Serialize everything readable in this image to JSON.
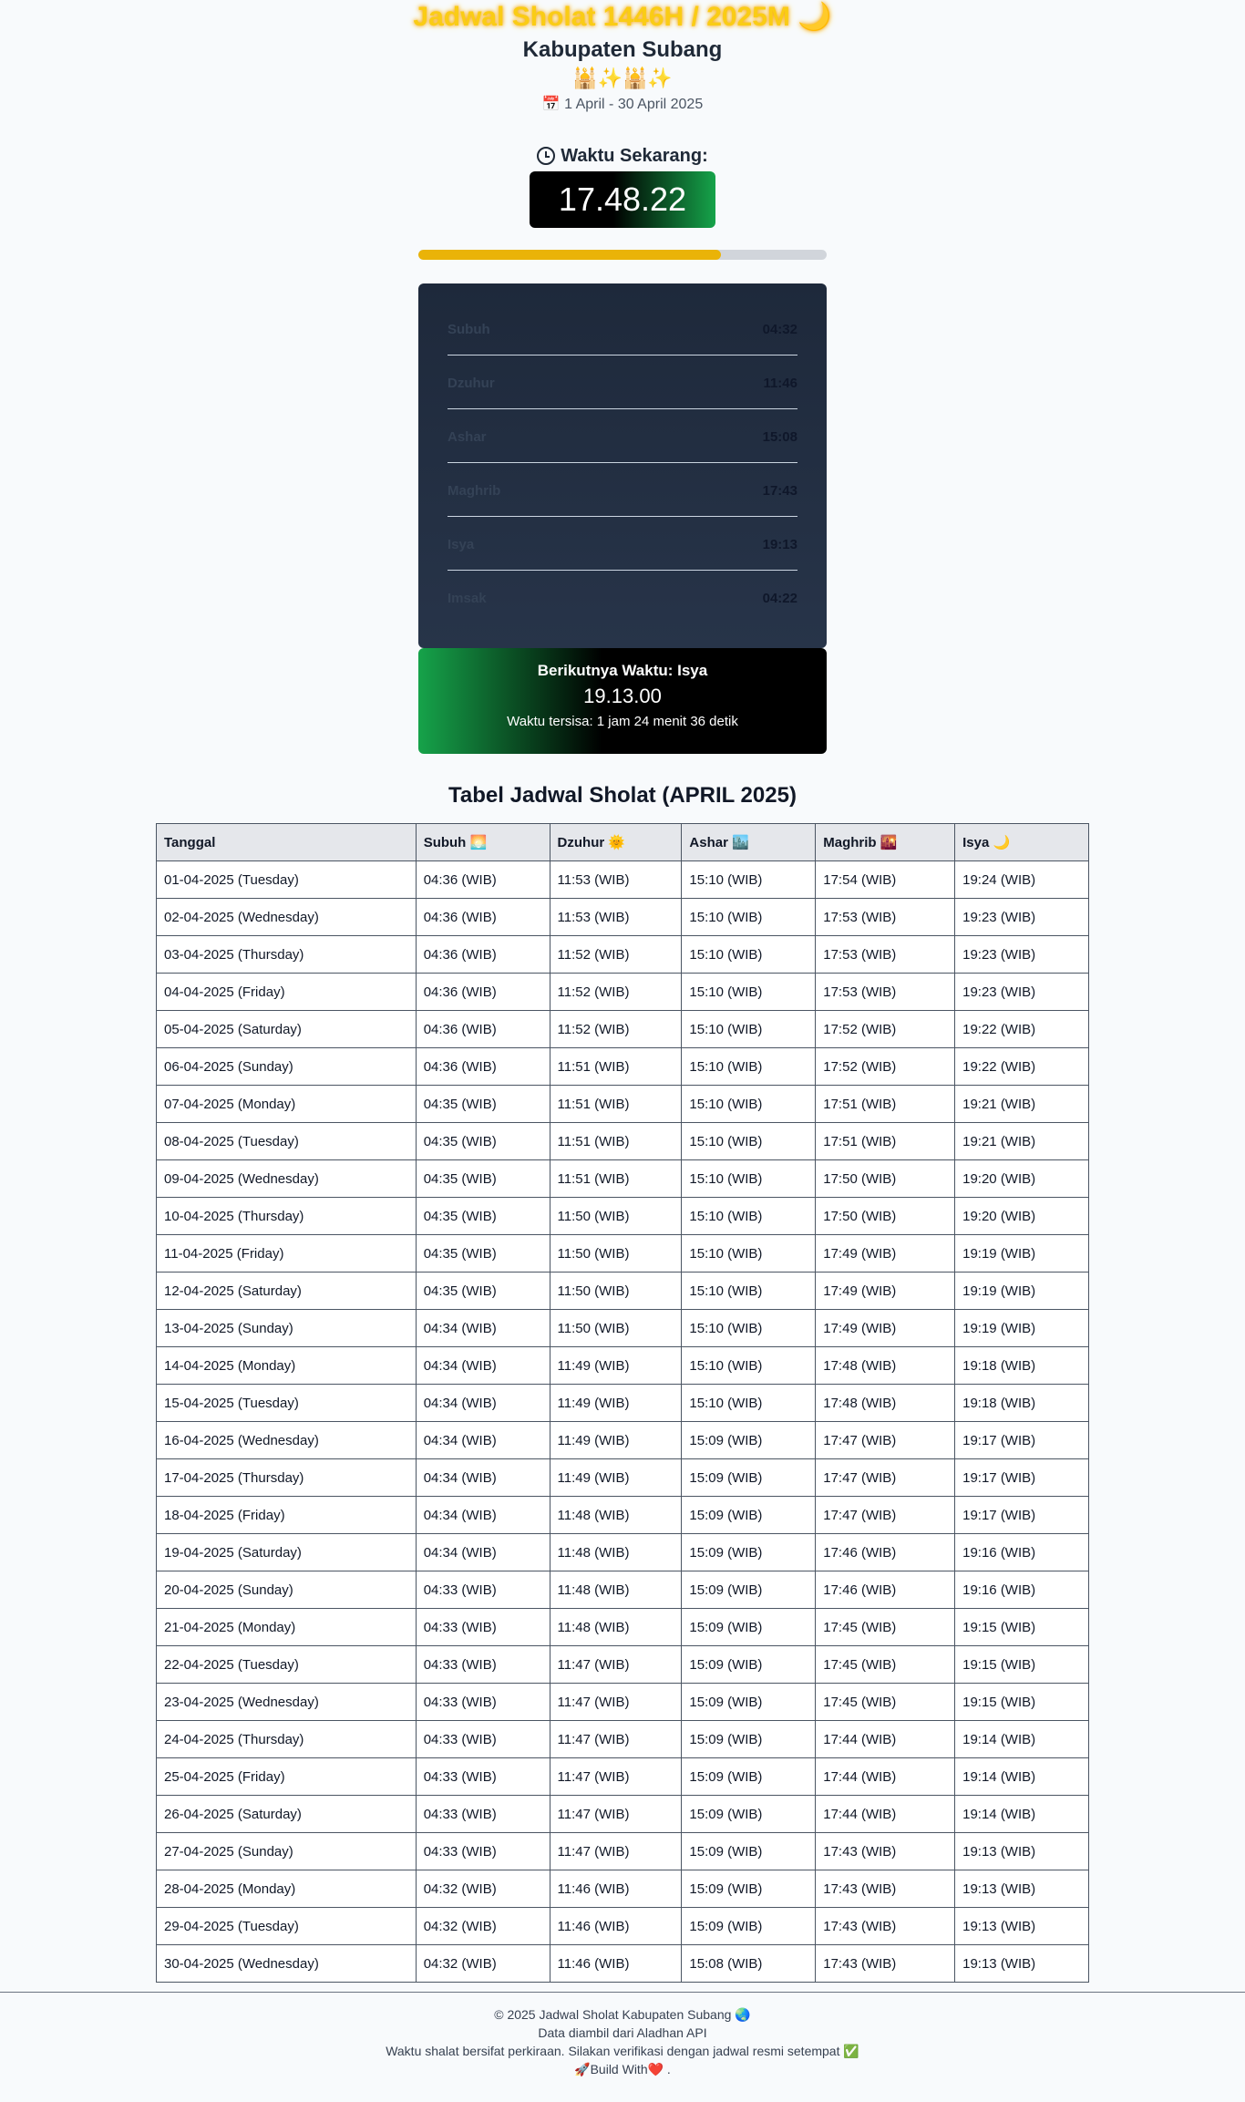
{
  "header": {
    "title": "Jadwal Sholat 1446H / 2025M 🌙",
    "subtitle": "Kabupaten Subang",
    "emojis": "🕌✨🕌✨",
    "date_range": "📅 1 April - 30 April 2025"
  },
  "now": {
    "label": "Waktu Sekarang:",
    "time": "17.48.22",
    "day_progress_fraction": 0.74
  },
  "prayer_times": [
    {
      "name": "Subuh",
      "time": "04:32"
    },
    {
      "name": "Dzuhur",
      "time": "11:46"
    },
    {
      "name": "Ashar",
      "time": "15:08"
    },
    {
      "name": "Maghrib",
      "time": "17:43"
    },
    {
      "name": "Isya",
      "time": "19:13"
    },
    {
      "name": "Imsak",
      "time": "04:22"
    }
  ],
  "next": {
    "label": "Berikutnya Waktu: Isya",
    "time": "19.13.00",
    "remaining": "Waktu tersisa: 1 jam 24 menit 36 detik"
  },
  "table": {
    "title": "Tabel Jadwal Sholat (APRIL 2025)",
    "headers": [
      "Tanggal",
      "Subuh 🌅",
      "Dzuhur 🌞",
      "Ashar 🏙️",
      "Maghrib 🌇",
      "Isya 🌙"
    ],
    "rows": [
      [
        "01-04-2025 (Tuesday)",
        "04:36 (WIB)",
        "11:53 (WIB)",
        "15:10 (WIB)",
        "17:54 (WIB)",
        "19:24 (WIB)"
      ],
      [
        "02-04-2025 (Wednesday)",
        "04:36 (WIB)",
        "11:53 (WIB)",
        "15:10 (WIB)",
        "17:53 (WIB)",
        "19:23 (WIB)"
      ],
      [
        "03-04-2025 (Thursday)",
        "04:36 (WIB)",
        "11:52 (WIB)",
        "15:10 (WIB)",
        "17:53 (WIB)",
        "19:23 (WIB)"
      ],
      [
        "04-04-2025 (Friday)",
        "04:36 (WIB)",
        "11:52 (WIB)",
        "15:10 (WIB)",
        "17:53 (WIB)",
        "19:23 (WIB)"
      ],
      [
        "05-04-2025 (Saturday)",
        "04:36 (WIB)",
        "11:52 (WIB)",
        "15:10 (WIB)",
        "17:52 (WIB)",
        "19:22 (WIB)"
      ],
      [
        "06-04-2025 (Sunday)",
        "04:36 (WIB)",
        "11:51 (WIB)",
        "15:10 (WIB)",
        "17:52 (WIB)",
        "19:22 (WIB)"
      ],
      [
        "07-04-2025 (Monday)",
        "04:35 (WIB)",
        "11:51 (WIB)",
        "15:10 (WIB)",
        "17:51 (WIB)",
        "19:21 (WIB)"
      ],
      [
        "08-04-2025 (Tuesday)",
        "04:35 (WIB)",
        "11:51 (WIB)",
        "15:10 (WIB)",
        "17:51 (WIB)",
        "19:21 (WIB)"
      ],
      [
        "09-04-2025 (Wednesday)",
        "04:35 (WIB)",
        "11:51 (WIB)",
        "15:10 (WIB)",
        "17:50 (WIB)",
        "19:20 (WIB)"
      ],
      [
        "10-04-2025 (Thursday)",
        "04:35 (WIB)",
        "11:50 (WIB)",
        "15:10 (WIB)",
        "17:50 (WIB)",
        "19:20 (WIB)"
      ],
      [
        "11-04-2025 (Friday)",
        "04:35 (WIB)",
        "11:50 (WIB)",
        "15:10 (WIB)",
        "17:49 (WIB)",
        "19:19 (WIB)"
      ],
      [
        "12-04-2025 (Saturday)",
        "04:35 (WIB)",
        "11:50 (WIB)",
        "15:10 (WIB)",
        "17:49 (WIB)",
        "19:19 (WIB)"
      ],
      [
        "13-04-2025 (Sunday)",
        "04:34 (WIB)",
        "11:50 (WIB)",
        "15:10 (WIB)",
        "17:49 (WIB)",
        "19:19 (WIB)"
      ],
      [
        "14-04-2025 (Monday)",
        "04:34 (WIB)",
        "11:49 (WIB)",
        "15:10 (WIB)",
        "17:48 (WIB)",
        "19:18 (WIB)"
      ],
      [
        "15-04-2025 (Tuesday)",
        "04:34 (WIB)",
        "11:49 (WIB)",
        "15:10 (WIB)",
        "17:48 (WIB)",
        "19:18 (WIB)"
      ],
      [
        "16-04-2025 (Wednesday)",
        "04:34 (WIB)",
        "11:49 (WIB)",
        "15:09 (WIB)",
        "17:47 (WIB)",
        "19:17 (WIB)"
      ],
      [
        "17-04-2025 (Thursday)",
        "04:34 (WIB)",
        "11:49 (WIB)",
        "15:09 (WIB)",
        "17:47 (WIB)",
        "19:17 (WIB)"
      ],
      [
        "18-04-2025 (Friday)",
        "04:34 (WIB)",
        "11:48 (WIB)",
        "15:09 (WIB)",
        "17:47 (WIB)",
        "19:17 (WIB)"
      ],
      [
        "19-04-2025 (Saturday)",
        "04:34 (WIB)",
        "11:48 (WIB)",
        "15:09 (WIB)",
        "17:46 (WIB)",
        "19:16 (WIB)"
      ],
      [
        "20-04-2025 (Sunday)",
        "04:33 (WIB)",
        "11:48 (WIB)",
        "15:09 (WIB)",
        "17:46 (WIB)",
        "19:16 (WIB)"
      ],
      [
        "21-04-2025 (Monday)",
        "04:33 (WIB)",
        "11:48 (WIB)",
        "15:09 (WIB)",
        "17:45 (WIB)",
        "19:15 (WIB)"
      ],
      [
        "22-04-2025 (Tuesday)",
        "04:33 (WIB)",
        "11:47 (WIB)",
        "15:09 (WIB)",
        "17:45 (WIB)",
        "19:15 (WIB)"
      ],
      [
        "23-04-2025 (Wednesday)",
        "04:33 (WIB)",
        "11:47 (WIB)",
        "15:09 (WIB)",
        "17:45 (WIB)",
        "19:15 (WIB)"
      ],
      [
        "24-04-2025 (Thursday)",
        "04:33 (WIB)",
        "11:47 (WIB)",
        "15:09 (WIB)",
        "17:44 (WIB)",
        "19:14 (WIB)"
      ],
      [
        "25-04-2025 (Friday)",
        "04:33 (WIB)",
        "11:47 (WIB)",
        "15:09 (WIB)",
        "17:44 (WIB)",
        "19:14 (WIB)"
      ],
      [
        "26-04-2025 (Saturday)",
        "04:33 (WIB)",
        "11:47 (WIB)",
        "15:09 (WIB)",
        "17:44 (WIB)",
        "19:14 (WIB)"
      ],
      [
        "27-04-2025 (Sunday)",
        "04:33 (WIB)",
        "11:47 (WIB)",
        "15:09 (WIB)",
        "17:43 (WIB)",
        "19:13 (WIB)"
      ],
      [
        "28-04-2025 (Monday)",
        "04:32 (WIB)",
        "11:46 (WIB)",
        "15:09 (WIB)",
        "17:43 (WIB)",
        "19:13 (WIB)"
      ],
      [
        "29-04-2025 (Tuesday)",
        "04:32 (WIB)",
        "11:46 (WIB)",
        "15:09 (WIB)",
        "17:43 (WIB)",
        "19:13 (WIB)"
      ],
      [
        "30-04-2025 (Wednesday)",
        "04:32 (WIB)",
        "11:46 (WIB)",
        "15:08 (WIB)",
        "17:43 (WIB)",
        "19:13 (WIB)"
      ]
    ]
  },
  "footer": {
    "line1": "© 2025 Jadwal Sholat Kabupaten Subang 🌏",
    "line2": "Data diambil dari Aladhan API",
    "line3": "Waktu shalat bersifat perkiraan. Silakan verifikasi dengan jadwal resmi setempat ✅",
    "line4": "🚀Build With❤️ ."
  },
  "colors": {
    "title": "#facc15",
    "progress_fill": "#eab308",
    "accent_green": "#16a34a",
    "panel_dark": "#1e293b"
  }
}
